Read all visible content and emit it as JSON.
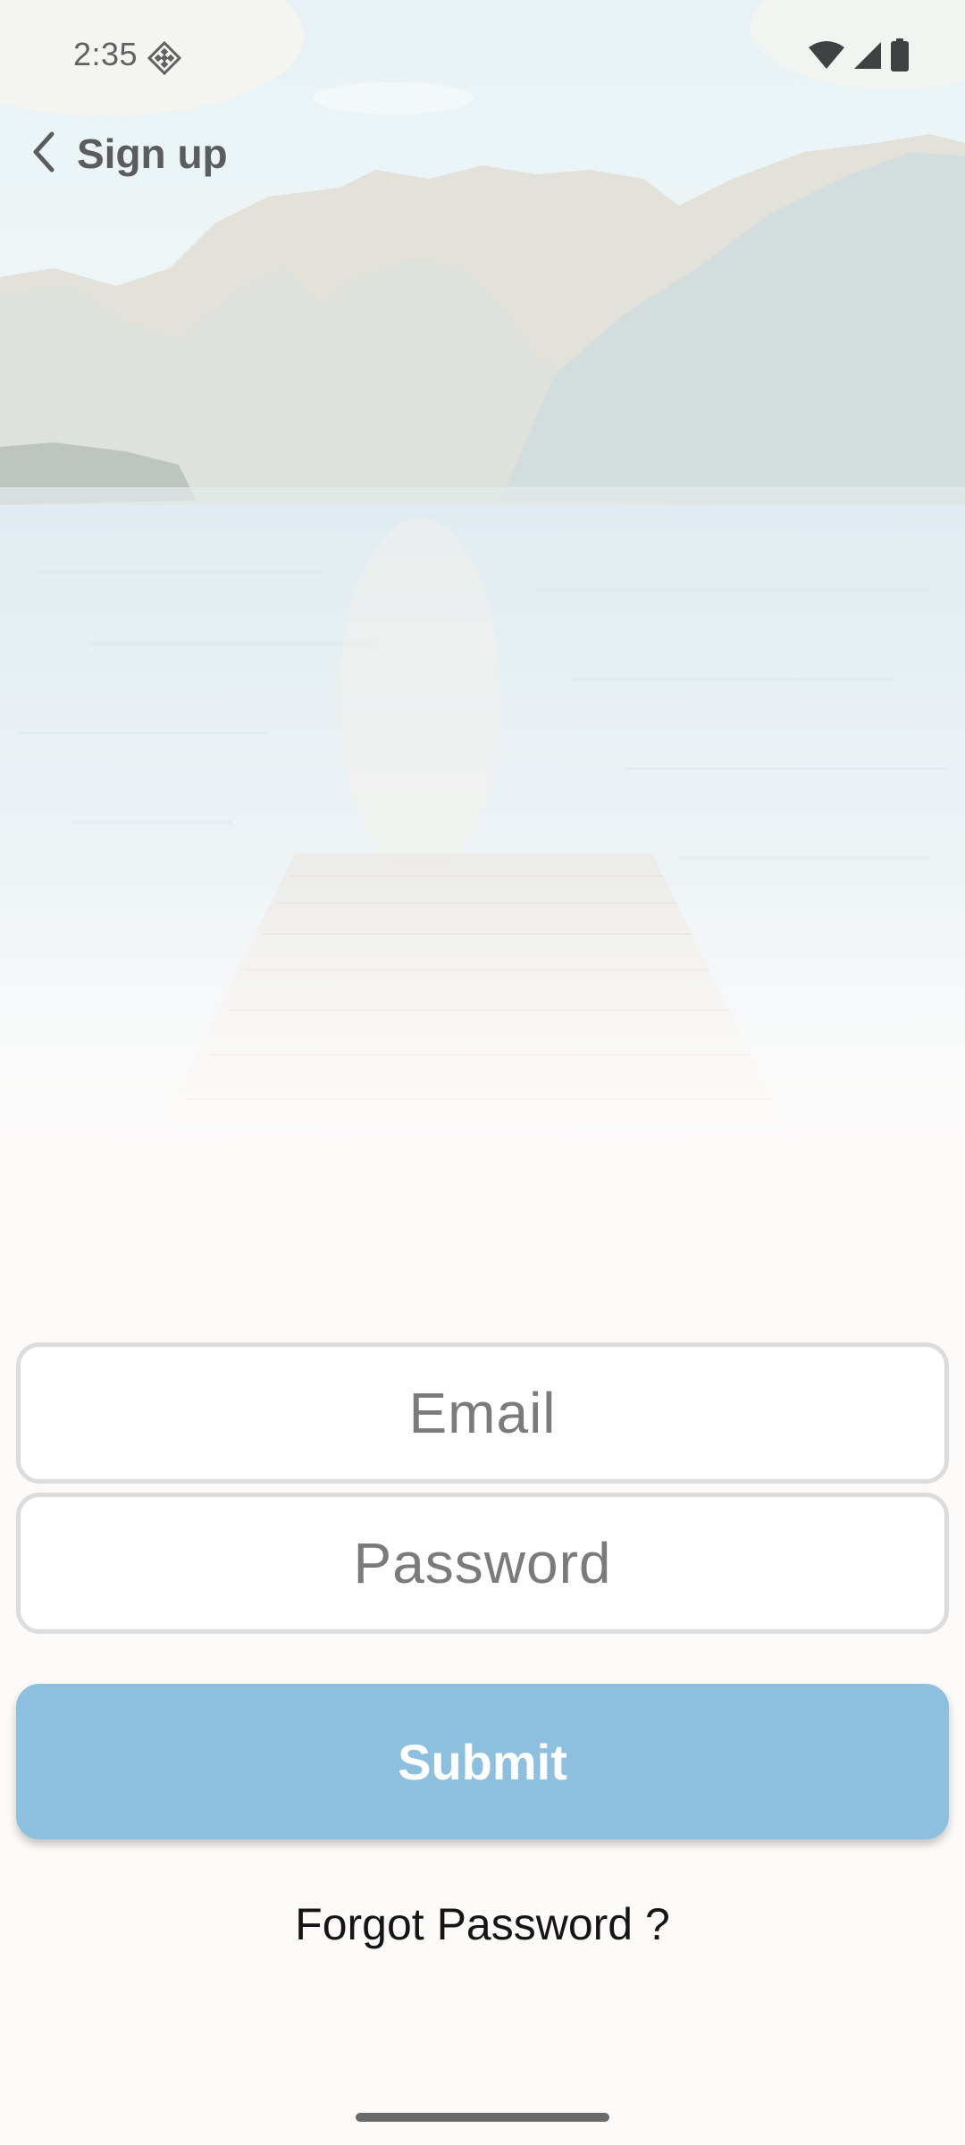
{
  "status_bar": {
    "time": "2:35",
    "app_icon": "diamond-grid-icon",
    "icons": [
      "wifi-icon",
      "signal-icon",
      "battery-icon"
    ]
  },
  "header": {
    "back_icon": "chevron-left-icon",
    "title": "Sign up"
  },
  "form": {
    "email": {
      "value": "",
      "placeholder": "Email"
    },
    "password": {
      "value": "",
      "placeholder": "Password"
    },
    "submit_label": "Submit",
    "forgot_label": "Forgot Password ?"
  },
  "colors": {
    "submit_bg": "#8dbfdf",
    "field_border": "#dcdcdc",
    "page_bg": "#fdfbfa"
  }
}
